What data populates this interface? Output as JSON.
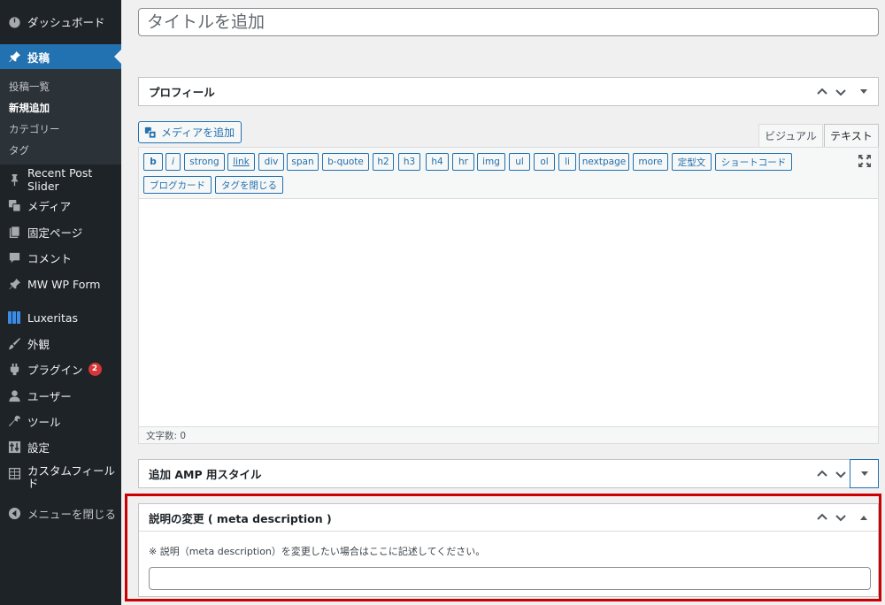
{
  "sidebar": {
    "dashboard": "ダッシュボード",
    "posts": "投稿",
    "submenu": [
      "投稿一覧",
      "新規追加",
      "カテゴリー",
      "タグ"
    ],
    "recent_post_slider": "Recent Post Slider",
    "media": "メディア",
    "pages": "固定ページ",
    "comments": "コメント",
    "mw_wp_form": "MW WP Form",
    "luxeritas": "Luxeritas",
    "appearance": "外観",
    "plugins": "プラグイン",
    "plugins_badge": "2",
    "users": "ユーザー",
    "tools": "ツール",
    "settings": "設定",
    "custom_fields": "カスタムフィールド",
    "collapse": "メニューを閉じる"
  },
  "title_input": {
    "placeholder": "タイトルを追加",
    "value": ""
  },
  "profile_box": {
    "title": "プロフィール"
  },
  "editor": {
    "add_media": "メディアを追加",
    "tab_visual": "ビジュアル",
    "tab_text": "テキスト",
    "buttons_row1": [
      "b",
      "i",
      "strong",
      "link",
      "div",
      "span",
      "b-quote",
      "h2",
      "h3",
      "h4",
      "hr",
      "img",
      "ul",
      "ol",
      "li",
      "nextpage",
      "more",
      "定型文",
      "ショートコード"
    ],
    "buttons_row2": [
      "ブログカード",
      "タグを閉じる"
    ],
    "char_count": "文字数: 0"
  },
  "amp_box": {
    "title": "追加 AMP 用スタイル"
  },
  "meta_box": {
    "title": "説明の変更 ( meta description )",
    "description": "※ 説明（meta description）を変更したい場合はここに記述してください。",
    "input_value": ""
  },
  "colors": {
    "sidebar_bg": "#1d2327",
    "accent": "#2271b1",
    "highlight": "#cc0000",
    "badge": "#d63638"
  }
}
